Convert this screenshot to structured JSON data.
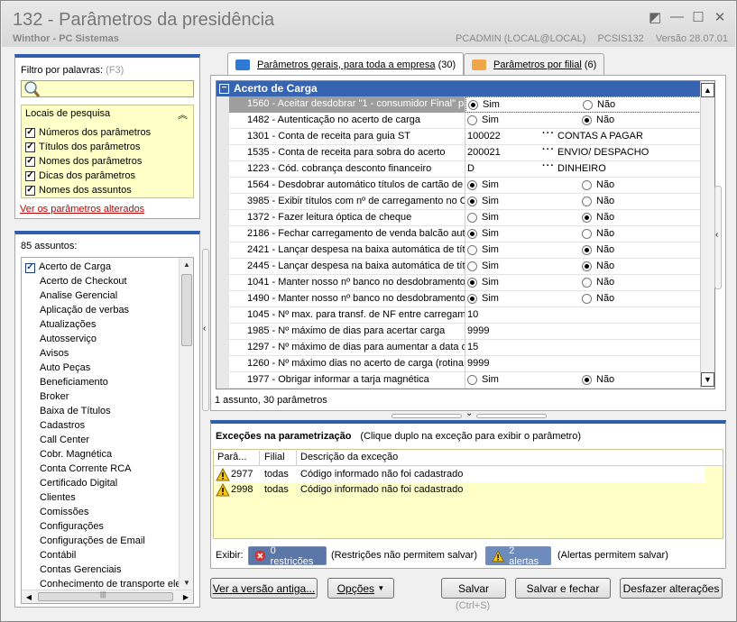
{
  "window": {
    "title": "132 - Parâmetros da presidência",
    "company": "Winthor - PC Sistemas",
    "user": "PCADMIN (LOCAL@LOCAL)",
    "module": "PCSIS132",
    "version": "Versão 28.07.01"
  },
  "filter": {
    "label": "Filtro por palavras:",
    "shortcut": "(F3)",
    "value": "",
    "locais_title": "Locais de pesquisa",
    "options": [
      {
        "label": "Números dos parâmetros",
        "checked": true
      },
      {
        "label": "Títulos dos parâmetros",
        "checked": true
      },
      {
        "label": "Nomes dos parâmetros",
        "checked": true
      },
      {
        "label": "Dicas dos parâmetros",
        "checked": true
      },
      {
        "label": "Nomes dos assuntos",
        "checked": true
      }
    ],
    "changed_link": "Ver os parâmetros alterados"
  },
  "assuntos": {
    "count_label": "85 assuntos:",
    "items": [
      "Acerto de Carga",
      "Acerto de Checkout",
      "Analise Gerencial",
      "Aplicação de verbas",
      "Atualizações",
      "Autosserviço",
      "Avisos",
      "Auto Peças",
      "Beneficiamento",
      "Broker",
      "Baixa de Títulos",
      "Cadastros",
      "Call Center",
      "Cobr. Magnética",
      "Conta Corrente RCA",
      "Certificado Digital",
      "Clientes",
      "Comissões",
      "Configurações",
      "Configurações de Email",
      "Contábil",
      "Contas Gerenciais",
      "Conhecimento de transporte ele"
    ],
    "scroll_glyph": "|||"
  },
  "tabs": [
    {
      "label": "Parâmetros gerais, para toda a empresa",
      "count": "(30)"
    },
    {
      "label": "Parâmetros por filial",
      "count": "(6)"
    }
  ],
  "group": {
    "title": "Acerto de Carga"
  },
  "radio_labels": {
    "sim": "Sim",
    "nao": "Não"
  },
  "rows": [
    {
      "name": "1560 - Aceitar desdobrar \"1 - consumidor Final\" para",
      "type": "radio",
      "value": "sim"
    },
    {
      "name": "1482 - Autenticação no acerto de carga",
      "type": "radio",
      "value": "nao"
    },
    {
      "name": "1301 - Conta de receita para guia ST",
      "type": "lookup",
      "code": "100022",
      "desc": "CONTAS A PAGAR"
    },
    {
      "name": "1535 - Conta de receita para sobra do acerto",
      "type": "lookup",
      "code": "200021",
      "desc": "ENVIO/ DESPACHO"
    },
    {
      "name": "1223 - Cód. cobrança desconto financeiro",
      "type": "lookup",
      "code": "D",
      "desc": "DINHEIRO"
    },
    {
      "name": "1564 - Desdobrar automático títulos de cartão de",
      "type": "radio",
      "value": "sim"
    },
    {
      "name": "3985 - Exibir títulos com nº de carregamento no Ca",
      "type": "radio",
      "value": "sim"
    },
    {
      "name": "1372 - Fazer leitura óptica de cheque",
      "type": "radio",
      "value": "nao"
    },
    {
      "name": "2186 - Fechar carregamento de venda balcão auto",
      "type": "radio",
      "value": "sim"
    },
    {
      "name": "2421 - Lançar despesa na baixa automática de títu",
      "type": "radio",
      "value": "nao"
    },
    {
      "name": "2445 - Lançar despesa na baixa automática de títu",
      "type": "radio",
      "value": "nao"
    },
    {
      "name": "1041 - Manter nosso nº banco no desdobramento",
      "type": "radio",
      "value": "sim"
    },
    {
      "name": "1490 - Manter nosso nº banco no desdobramento",
      "type": "radio",
      "value": "sim"
    },
    {
      "name": "1045 - Nº max. para transf. de NF entre carregam",
      "type": "text",
      "code": "10"
    },
    {
      "name": "1985 - Nº máximo de dias para acertar carga",
      "type": "text",
      "code": "9999"
    },
    {
      "name": "1297 - Nº máximo de dias para aumentar a data d",
      "type": "text",
      "code": "15"
    },
    {
      "name": "1260 - Nº máximo dias no acerto de carga (rotina",
      "type": "text",
      "code": "9999"
    },
    {
      "name": "1977 - Obrigar informar a tarja magnética",
      "type": "radio",
      "value": "nao"
    }
  ],
  "grid_status": "1 assunto, 30 parâmetros",
  "exceptions": {
    "title": "Exceções na parametrização",
    "hint": "(Clique duplo na exceção para exibir o parâmetro)",
    "columns": [
      "Parâ...",
      "Filial",
      "Descrição da exceção"
    ],
    "rows": [
      {
        "param": "2977",
        "filial": "todas",
        "desc": "Código informado não foi cadastrado"
      },
      {
        "param": "2998",
        "filial": "todas",
        "desc": "Código informado não foi cadastrado"
      }
    ],
    "exibir_label": "Exibir:",
    "restricoes": "0 restrições",
    "restricoes_note": "(Restrições não permitem salvar)",
    "alertas": "2 alertas",
    "alertas_note": "(Alertas permitem salvar)"
  },
  "buttons": {
    "old_version": "Ver a versão antiga...",
    "options": "Opções",
    "save": "Salvar",
    "save_shortcut": "(Ctrl+S)",
    "save_close": "Salvar e fechar",
    "undo": "Desfazer alterações"
  },
  "colors": {
    "accent": "#2f5fab",
    "group_header": "#3664b0",
    "highlight": "#ffffc8"
  }
}
